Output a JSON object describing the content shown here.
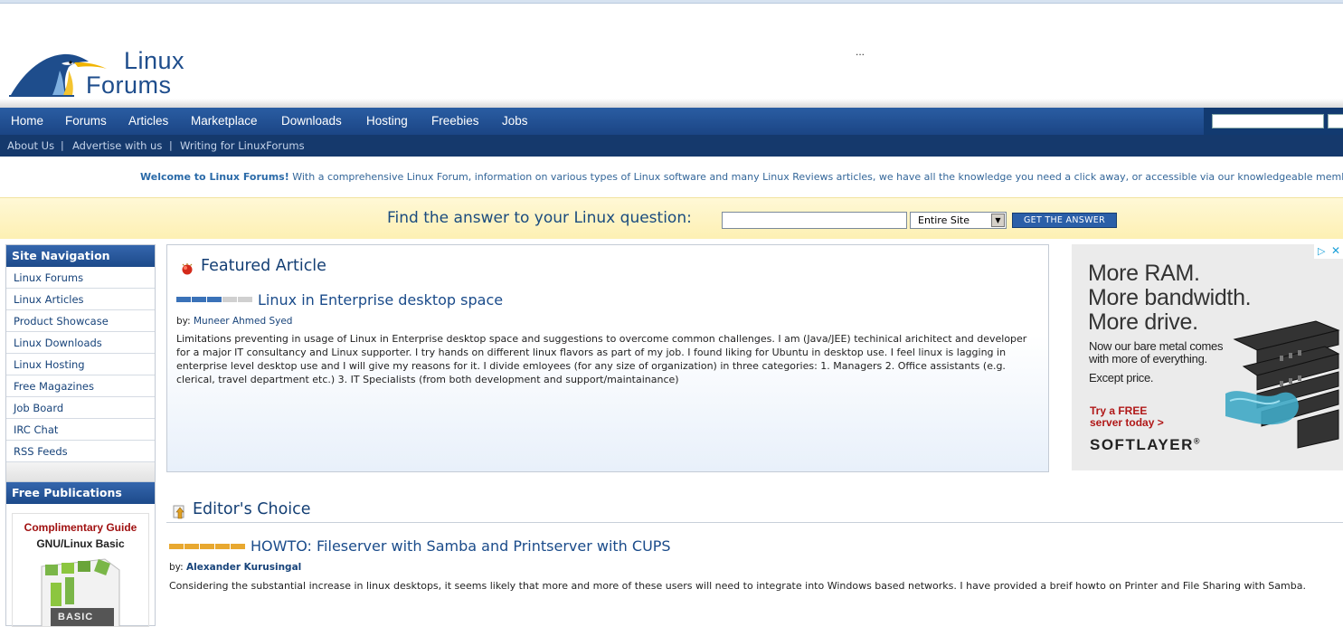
{
  "logo": {
    "line1": "Linux",
    "line2": "Forums"
  },
  "header_dots": "...",
  "nav": {
    "items": [
      {
        "label": "Home"
      },
      {
        "label": "Forums"
      },
      {
        "label": "Articles"
      },
      {
        "label": "Marketplace"
      },
      {
        "label": "Downloads"
      },
      {
        "label": "Hosting"
      },
      {
        "label": "Freebies"
      },
      {
        "label": "Jobs"
      }
    ]
  },
  "subnav": {
    "items": [
      {
        "label": "About Us"
      },
      {
        "label": "Advertise with us"
      },
      {
        "label": "Writing for LinuxForums"
      }
    ],
    "separator": "|"
  },
  "welcome": {
    "bold": "Welcome to Linux Forums!",
    "text": " With a comprehensive Linux Forum, information on various types of Linux software and many Linux Reviews articles, we have all the knowledge you need a click away, or accessible via our knowledgeable members."
  },
  "find": {
    "label": "Find the answer to your Linux question:",
    "input_value": "",
    "scope": "Entire Site",
    "button": "GET THE ANSWER"
  },
  "sidebar": {
    "nav_title": "Site Navigation",
    "items": [
      {
        "label": "Linux Forums"
      },
      {
        "label": "Linux Articles"
      },
      {
        "label": "Product Showcase"
      },
      {
        "label": "Linux Downloads"
      },
      {
        "label": "Linux Hosting"
      },
      {
        "label": "Free Magazines"
      },
      {
        "label": "Job Board"
      },
      {
        "label": "IRC Chat"
      },
      {
        "label": "RSS Feeds"
      }
    ],
    "pub_title": "Free Publications",
    "pub_line1": "Complimentary Guide",
    "pub_line2": "GNU/Linux Basic",
    "pub_cover_text": "BASIC"
  },
  "featured": {
    "section_title": "Featured Article",
    "article_title": "Linux in Enterprise desktop space",
    "by_label": "by:",
    "author": "Muneer Ahmed Syed",
    "summary": "Limitations preventing in usage of Linux in Enterprise desktop space and suggestions to overcome common challenges. I am (Java/JEE) techinical arichitect and developer for a major IT consultancy and Linux supporter. I try hands on different linux flavors as part of my job. I found liking for Ubuntu in desktop use. I feel linux is lagging in enterprise level desktop use and I will give my reasons for it. I divide emloyees (for any size of organization) in three categories: 1. Managers 2. Office assistants (e.g. clerical, travel department etc.) 3. IT Specialists (from both development and support/maintainance)",
    "rating_filled": 3,
    "rating_total": 5
  },
  "editors": {
    "section_title": "Editor's Choice",
    "article_title": "HOWTO: Fileserver with Samba and Printserver with CUPS",
    "by_label": "by:",
    "author": "Alexander Kurusingal",
    "summary": "Considering the substantial increase in linux desktops, it seems likely that more and more of these users will need to integrate into Windows based networks. I have provided a breif howto on Printer and File Sharing with Samba.",
    "rating_filled": 5,
    "rating_total": 5
  },
  "ad": {
    "h1": "More RAM.",
    "h2": "More bandwidth.",
    "h3": "More drive.",
    "s1": "Now our bare metal comes",
    "s2": "with more of everything.",
    "s3": "Except price.",
    "cta1": "Try a FREE",
    "cta2": "server today >",
    "brand": "SOFTLAYER",
    "brand_mark": "®"
  },
  "colors": {
    "nav": "#1f4d8e",
    "subnav": "#15396c",
    "link": "#17437a",
    "findbar": "#fdf2bd"
  },
  "icons": [
    "penguin-logo-icon",
    "featured-article-icon",
    "editors-choice-icon",
    "select-arrow-icon",
    "adchoices-icon",
    "close-icon"
  ]
}
